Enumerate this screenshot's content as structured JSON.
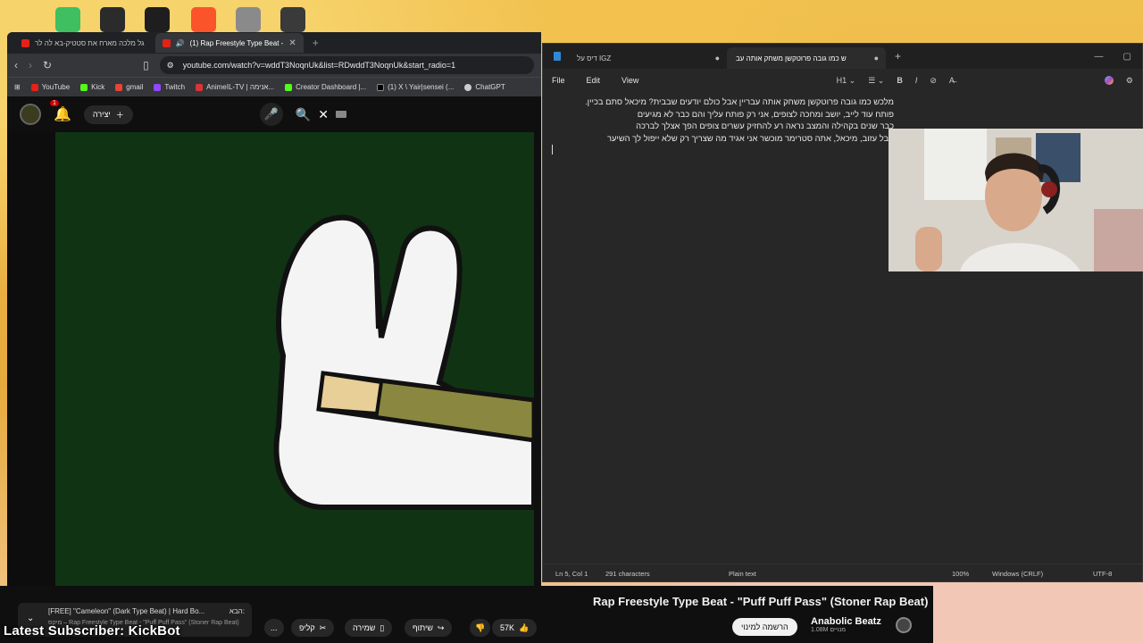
{
  "browser": {
    "tabs": [
      {
        "label": "גל מלכה מארח את סטטיק-בא לה לר"
      },
      {
        "label": "(1) Rap Freestyle Type Beat -"
      }
    ],
    "url": "youtube.com/watch?v=wddT3NoqnUk&list=RDwddT3NoqnUk&start_radio=1",
    "bookmarks": [
      "YouTube",
      "Kick",
      "gmail",
      "Twitch",
      "AnimeIL-TV | אנימה...",
      "Creator Dashboard |...",
      "(1) X \\ Yair|sensei (...",
      "ChatGPT"
    ],
    "colors": {
      "youtube": "#e62117",
      "kick": "#53fc18",
      "twitch": "#9146ff",
      "gmail": "#ea4335"
    }
  },
  "youtube": {
    "create_label": "יצירה",
    "notification_count": "1",
    "video_title": "Rap Freestyle Type Beat - \"Puff Puff Pass\" (Stoner Rap Beat)",
    "channel_name": "Anabolic Beatz",
    "subscribers": "1.08M מנויים",
    "subscribe_label": "הרשמה למינוי",
    "likes": "57K",
    "share_label": "שיתוף",
    "save_label": "שמירה",
    "clip_label": "קליפ",
    "more_label": "...",
    "up_next_prefix": "הבא:",
    "up_next_title": "[FREE] \"Cameleon\" (Dark Type Beat) | Hard Bo...",
    "up_next_sub": "מיקס – Rap Freestyle Type Beat - \"Puff Puff Pass\" (Stoner Rap Beat)",
    "player_bg": "#103314"
  },
  "notepad": {
    "tabs": [
      {
        "label": "דיס על IGZ"
      },
      {
        "label": "ש כמו גובה פרוטקשן משחק אותה עב"
      }
    ],
    "menu": {
      "file": "File",
      "edit": "Edit",
      "view": "View"
    },
    "heading": "H1",
    "lines": [
      "מלכש כמו גובה פרוטקשן משחק אותה עבריין אבל כולם יודעים שבבית? מיכאל סתם בכיין.",
      "פותח עוד לייב, יושב ומחכה לצופים, אני רק פותח עליך והם כבר לא מגיעים",
      "כבר שנים בקהילה והמצב נראה רע להחזיק עשרים צופים הפך אצלך לברכה",
      "אבל עזוב, מיכאל, אתה סטרימר מוכשר אני אגיד מה שצריך  רק שלא ייפול לך השיער"
    ],
    "status": {
      "position": "Ln 5, Col 1",
      "characters": "291 characters",
      "format": "Plain text",
      "zoom": "100%",
      "line_ending": "Windows (CRLF)",
      "encoding": "UTF-8"
    }
  },
  "overlay": {
    "latest_subscriber": "Latest Subscriber: KickBot"
  }
}
